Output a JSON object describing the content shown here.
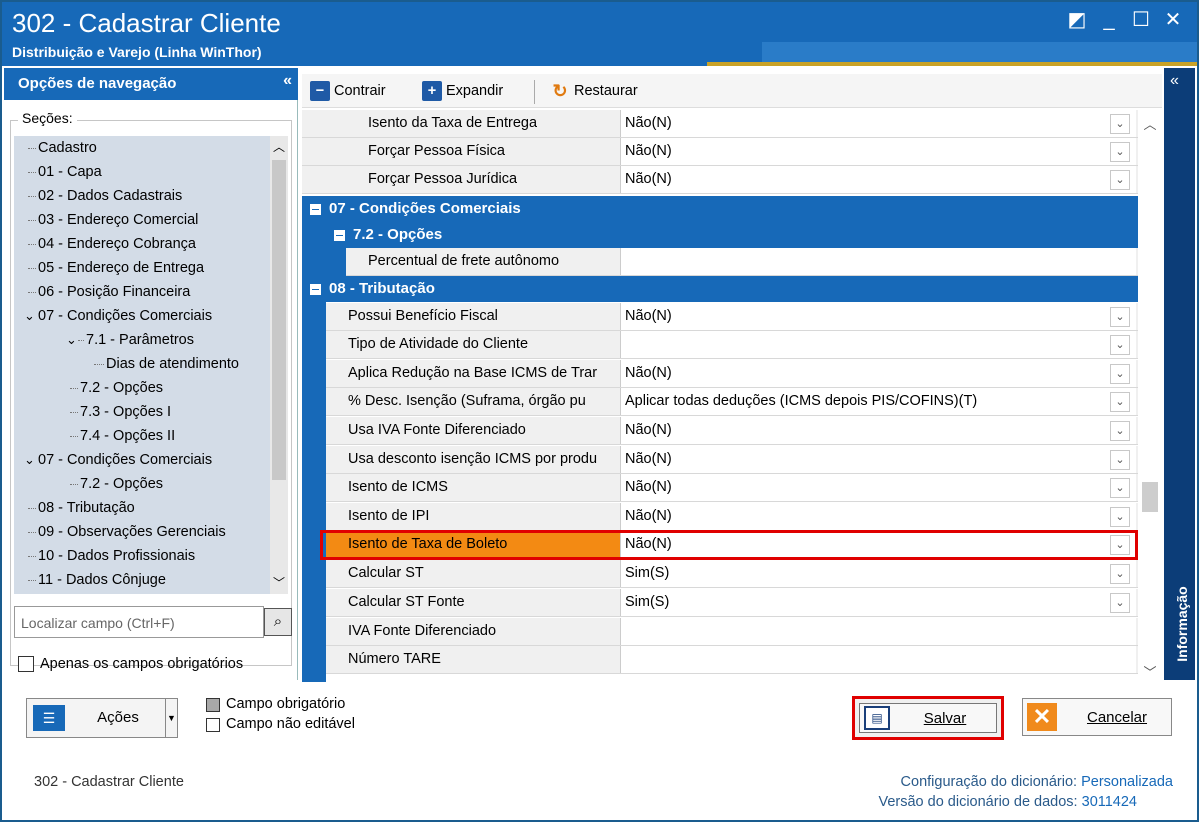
{
  "window": {
    "title": "302 - Cadastrar Cliente",
    "subtitle": "Distribuição e Varejo (Linha WinThor)",
    "buttons": {
      "restore": "◩",
      "minimize": "_",
      "maximize": "☐",
      "close": "✕"
    }
  },
  "nav": {
    "header": "Opções de navegação",
    "collapse_glyph": "«",
    "sections_label": "Seções:",
    "tree": [
      {
        "label": "Cadastro"
      },
      {
        "label": "01 - Capa"
      },
      {
        "label": "02 - Dados Cadastrais"
      },
      {
        "label": "03 - Endereço Comercial"
      },
      {
        "label": "04 - Endereço Cobrança"
      },
      {
        "label": "05 - Endereço de Entrega"
      },
      {
        "label": "06 - Posição Financeira"
      },
      {
        "label": "07 - Condições Comerciais"
      },
      {
        "label": "7.1 - Parâmetros"
      },
      {
        "label": "Dias de atendimento"
      },
      {
        "label": "7.2 - Opções"
      },
      {
        "label": "7.3 - Opções I"
      },
      {
        "label": "7.4 - Opções II"
      },
      {
        "label": "07 - Condições Comerciais"
      },
      {
        "label": "7.2 - Opções"
      },
      {
        "label": "08 - Tributação"
      },
      {
        "label": "09 - Observações Gerenciais"
      },
      {
        "label": "10 - Dados Profissionais"
      },
      {
        "label": "11 - Dados Cônjuge"
      }
    ],
    "search_placeholder": "Localizar campo (Ctrl+F)",
    "only_required_label": "Apenas os campos obrigatórios"
  },
  "toolbar": {
    "collapse_label": "Contrair",
    "expand_label": "Expandir",
    "restore_label": "Restaurar"
  },
  "grid": {
    "rows_top": [
      {
        "label": "Isento da Taxa de Entrega",
        "value": "Não(N)"
      },
      {
        "label": "Forçar Pessoa Física",
        "value": "Não(N)"
      },
      {
        "label": "Forçar Pessoa Jurídica",
        "value": "Não(N)"
      }
    ],
    "section_07": "07 - Condições Comerciais",
    "subsection_72": "7.2 - Opções",
    "row_frete": {
      "label": "Percentual de frete autônomo",
      "value": ""
    },
    "section_08": "08 - Tributação",
    "rows_trib": [
      {
        "label": "Possui Benefício Fiscal",
        "value": "Não(N)"
      },
      {
        "label": "Tipo de Atividade do Cliente",
        "value": ""
      },
      {
        "label": "Aplica Redução na Base ICMS de Trar",
        "value": "Não(N)"
      },
      {
        "label": "% Desc. Isenção (Suframa, órgão pu",
        "value": "Aplicar todas deduções (ICMS depois PIS/COFINS)(T)"
      },
      {
        "label": "Usa IVA Fonte Diferenciado",
        "value": "Não(N)"
      },
      {
        "label": "Usa desconto isenção ICMS por produ",
        "value": "Não(N)"
      },
      {
        "label": "Isento de ICMS",
        "value": "Não(N)"
      },
      {
        "label": "Isento de IPI",
        "value": "Não(N)"
      },
      {
        "label": "Isento de Taxa de Boleto",
        "value": "Não(N)"
      },
      {
        "label": "Calcular ST",
        "value": "Sim(S)"
      },
      {
        "label": "Calcular ST Fonte",
        "value": "Sim(S)"
      },
      {
        "label": "IVA Fonte Diferenciado",
        "value": ""
      },
      {
        "label": "Número TARE",
        "value": ""
      }
    ]
  },
  "info_pane": {
    "label": "Informação",
    "collapse_glyph": "«"
  },
  "bottom": {
    "actions_label": "Ações",
    "legend_required": "Campo obrigatório",
    "legend_readonly": "Campo não editável",
    "save_label": "Salvar",
    "cancel_label": "Cancelar"
  },
  "status": {
    "left": "302 - Cadastrar Cliente",
    "dict_config_label": "Configuração do dicionário:",
    "dict_config_value": "Personalizada",
    "dict_version_label": "Versão do dicionário de dados:",
    "dict_version_value": "3011424"
  },
  "colors": {
    "accent": "#1769b8",
    "highlight": "#f38a13",
    "outline": "#e00000"
  }
}
